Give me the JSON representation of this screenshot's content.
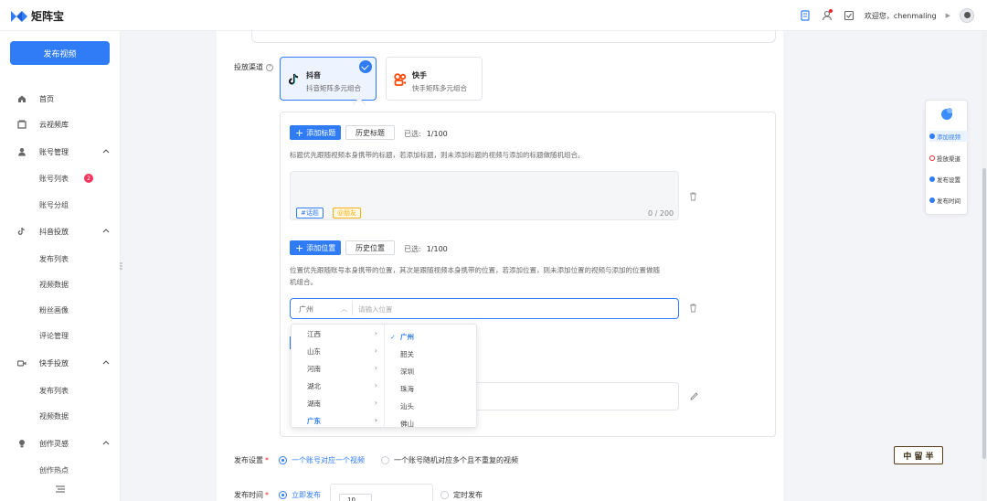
{
  "app": {
    "name": "矩阵宝"
  },
  "header": {
    "welcome": "欢迎您，chenmaling"
  },
  "sidebar": {
    "publish_button": "发布视频",
    "items": [
      {
        "label": "首页"
      },
      {
        "label": "云视频库"
      },
      {
        "label": "账号管理"
      },
      {
        "label": "账号列表",
        "badge": "2"
      },
      {
        "label": "账号分组"
      },
      {
        "label": "抖音投放"
      },
      {
        "label": "发布列表"
      },
      {
        "label": "视频数据"
      },
      {
        "label": "粉丝画像"
      },
      {
        "label": "评论管理"
      },
      {
        "label": "快手投放"
      },
      {
        "label": "发布列表"
      },
      {
        "label": "视频数据"
      },
      {
        "label": "创作灵感"
      },
      {
        "label": "创作热点"
      }
    ]
  },
  "form": {
    "channel_label": "投放渠道",
    "channels": [
      {
        "name": "抖音",
        "desc": "抖音矩阵多元组合",
        "selected": true
      },
      {
        "name": "快手",
        "desc": "快手矩阵多元组合",
        "selected": false
      }
    ],
    "title_section": {
      "add_button": "添加标题",
      "history_button": "历史标题",
      "selected_label": "已选:",
      "selected_value": "1/100",
      "description": "标题优先跟随视频本身携带的标题，若添加标题，则未添加标题的视频与添加的标题做随机组合。",
      "tags": [
        "#话题",
        "@朋友"
      ],
      "counter": "0 / 200"
    },
    "location_section": {
      "add_button": "添加位置",
      "history_button": "历史位置",
      "selected_label": "已选:",
      "selected_value": "1/100",
      "description_line1": "位置优先跟随账号本身携带的位置，其次是跟随视频本身携带的位置，若添加位置，则未添加位置的视频与添加的位置做随",
      "description_line2": "机组合。",
      "city": "广州",
      "placeholder": "请输入位置",
      "provinces": [
        "江西",
        "山东",
        "河南",
        "湖北",
        "湖南",
        "广东"
      ],
      "active_province": "广东",
      "cities": [
        "广州",
        "韶关",
        "深圳",
        "珠海",
        "汕头",
        "佛山"
      ],
      "active_city": "广州"
    },
    "publish_setting": {
      "label": "发布设置",
      "options": [
        "一个账号对应一个视频",
        "一个账号随机对应多个且不重复的视频"
      ],
      "selected": 0
    },
    "publish_time": {
      "label": "发布时间",
      "options": [
        "立即发布",
        "定时发布"
      ],
      "selected": 0,
      "value": "10"
    }
  },
  "steps": {
    "items": [
      {
        "label": "添加视频",
        "state": "active"
      },
      {
        "label": "投放渠道",
        "state": "warn"
      },
      {
        "label": "发布设置",
        "state": "done"
      },
      {
        "label": "发布时间",
        "state": "done"
      }
    ]
  },
  "stamp_text": "中 留 半",
  "colors": {
    "primary": "#2f7cf6",
    "badge": "#f5365c"
  }
}
